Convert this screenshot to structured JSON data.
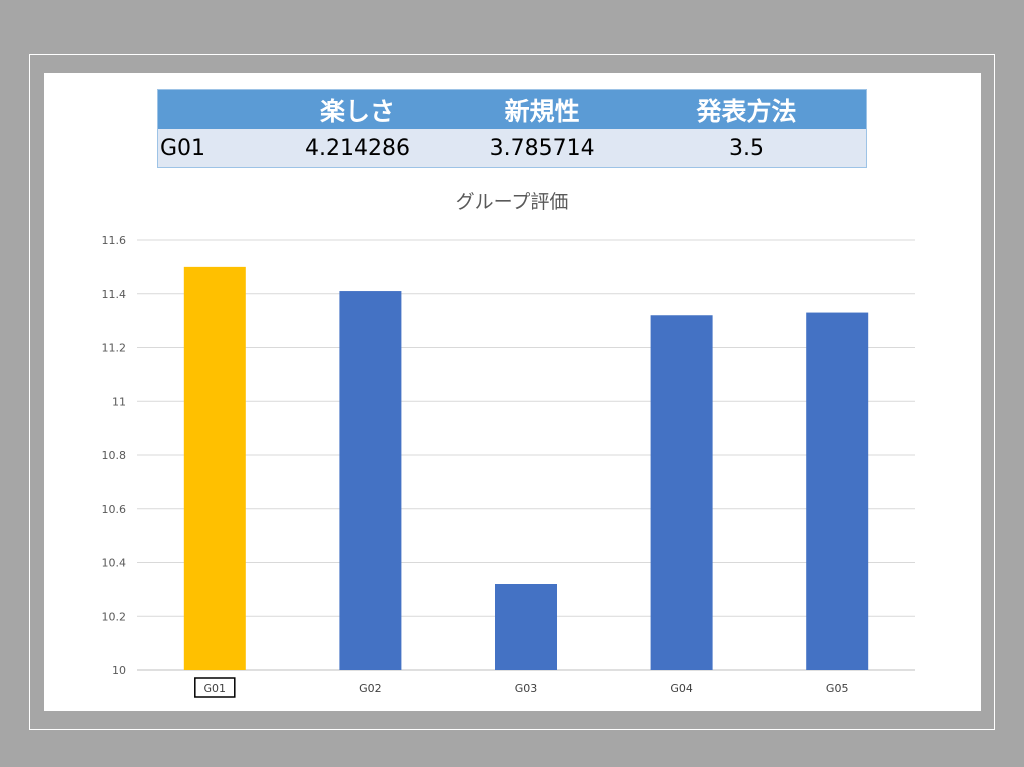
{
  "table": {
    "headers": [
      "",
      "楽しさ",
      "新規性",
      "発表方法"
    ],
    "rows": [
      [
        "G01",
        "4.214286",
        "3.785714",
        "3.5"
      ]
    ]
  },
  "colors": {
    "background": "#a6a6a6",
    "table_header": "#5b9bd5",
    "table_row": "#dfe7f3",
    "bar_default": "#4472c4",
    "bar_highlight": "#ffc000"
  },
  "chart_data": {
    "type": "bar",
    "title": "グループ評価",
    "xlabel": "",
    "ylabel": "",
    "categories": [
      "G01",
      "G02",
      "G03",
      "G04",
      "G05"
    ],
    "values": [
      11.5,
      11.41,
      10.32,
      11.32,
      11.33
    ],
    "ylim": [
      10,
      11.6
    ],
    "yticks": [
      "10",
      "10.2",
      "10.4",
      "10.6",
      "10.8",
      "11",
      "11.2",
      "11.4",
      "11.6"
    ],
    "highlight": "G01",
    "grid": true,
    "legend": "none"
  }
}
